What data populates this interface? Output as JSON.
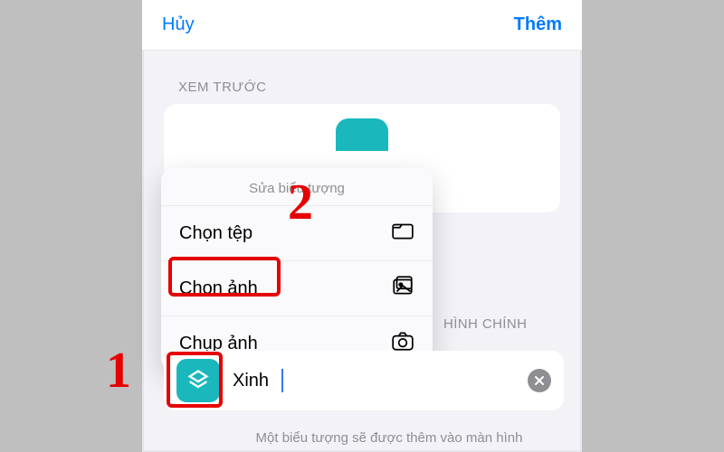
{
  "navbar": {
    "cancel": "Hủy",
    "add": "Thêm"
  },
  "sections": {
    "preview": "XEM TRƯỚC",
    "main": "HÌNH CHÍNH"
  },
  "menu": {
    "title": "Sửa biểu tượng",
    "items": [
      {
        "label": "Chọn tệp",
        "icon": "folder-icon"
      },
      {
        "label": "Chọn ảnh",
        "icon": "gallery-icon"
      },
      {
        "label": "Chụp ảnh",
        "icon": "camera-icon"
      }
    ]
  },
  "name_row": {
    "value": "Xinh"
  },
  "footer": "Một biểu tượng sẽ được thêm vào màn hình",
  "annotations": {
    "one": "1",
    "two": "2"
  },
  "colors": {
    "accent": "#007aff",
    "teal": "#1ab8bd",
    "annotation": "#e60000"
  }
}
